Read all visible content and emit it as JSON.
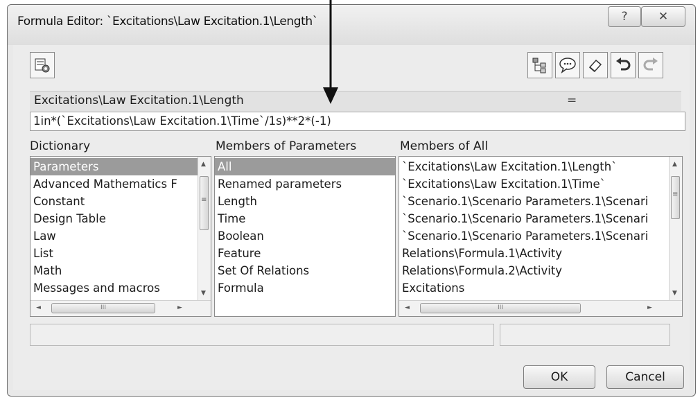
{
  "window": {
    "title": "Formula Editor: `Excitations\\Law Excitation.1\\Length`",
    "help_label": "?",
    "close_label": "✕"
  },
  "toolbar": {
    "left_icon": "formula-tool-icon",
    "right_icons": [
      "tree-icon",
      "speech-icon",
      "eraser-icon",
      "undo-icon",
      "redo-icon"
    ]
  },
  "parameter": {
    "name": "Excitations\\Law Excitation.1\\Length",
    "equals": "="
  },
  "formula": {
    "value": "1in*(`Excitations\\Law Excitation.1\\Time`/1s)**2*(-1)"
  },
  "dictionary": {
    "label": "Dictionary",
    "items": [
      "Parameters",
      "Advanced Mathematics F",
      "Constant",
      "Design Table",
      "Law",
      "List",
      "Math",
      "Messages and macros"
    ],
    "selected_index": 0
  },
  "members_of_parameters": {
    "label": "Members of Parameters",
    "items": [
      "All",
      "Renamed parameters",
      "Length",
      "Time",
      "Boolean",
      "Feature",
      "Set Of Relations",
      "Formula"
    ],
    "selected_index": 0
  },
  "members_of_all": {
    "label": "Members of All",
    "items": [
      "`Excitations\\Law Excitation.1\\Length`",
      "`Excitations\\Law Excitation.1\\Time`",
      "`Scenario.1\\Scenario Parameters.1\\Scenari",
      "`Scenario.1\\Scenario Parameters.1\\Scenari",
      "`Scenario.1\\Scenario Parameters.1\\Scenari",
      "Relations\\Formula.1\\Activity",
      "Relations\\Formula.2\\Activity",
      "Excitations"
    ]
  },
  "scroll": {
    "thumb_glyph": "III",
    "up": "▲",
    "down": "▼",
    "left": "◄",
    "right": "►",
    "grip": "≡"
  },
  "buttons": {
    "ok": "OK",
    "cancel": "Cancel"
  }
}
